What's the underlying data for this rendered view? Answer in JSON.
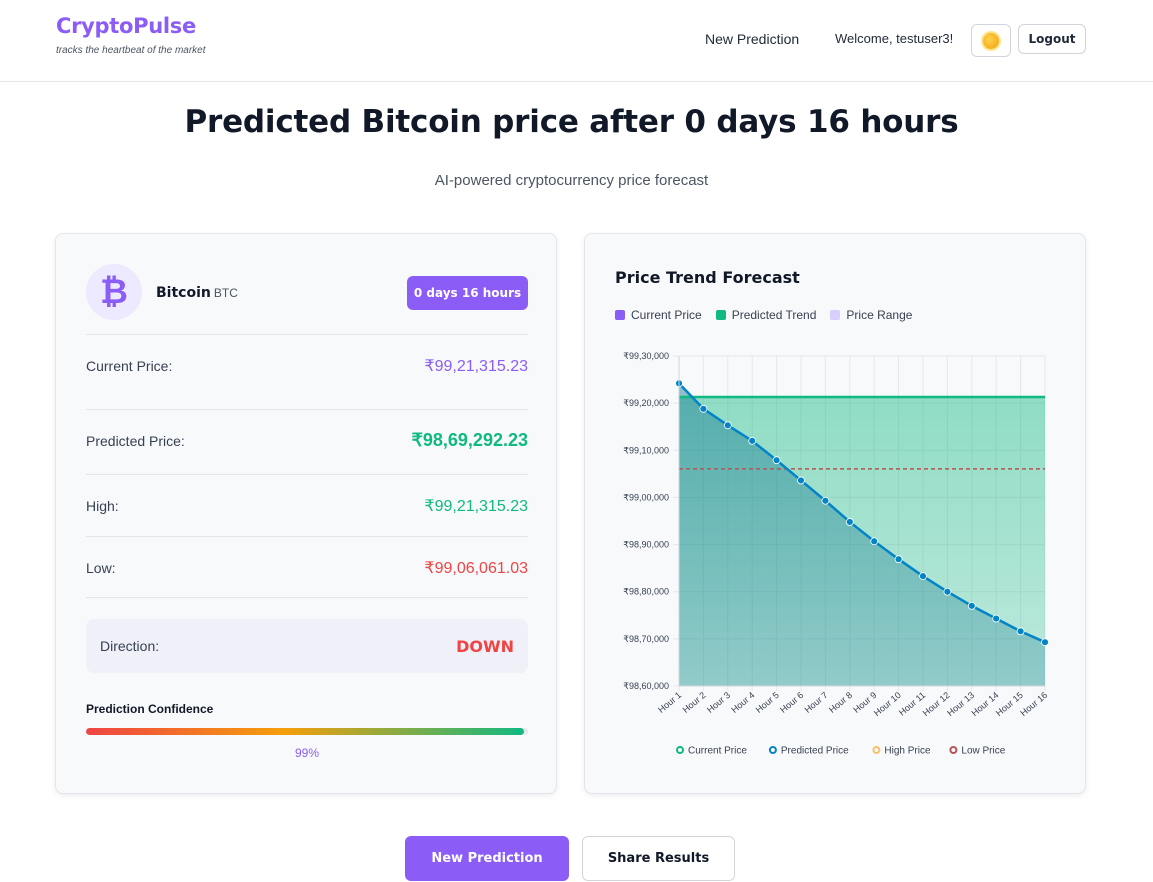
{
  "header": {
    "brand": "CryptoPulse",
    "tagline": "tracks the heartbeat of the market",
    "nav_new_prediction": "New Prediction",
    "welcome": "Welcome, testuser3!",
    "theme_icon": "sun-icon",
    "logout": "Logout"
  },
  "page": {
    "title": "Predicted Bitcoin price after 0 days 16 hours",
    "subtitle": "AI-powered cryptocurrency price forecast"
  },
  "coin": {
    "icon": "bitcoin-icon",
    "symbol_glyph": "₿",
    "name": "Bitcoin",
    "ticker": "BTC",
    "duration": "0 days 16 hours"
  },
  "prices": {
    "current_label": "Current Price:",
    "current_value": "₹99,21,315.23",
    "predicted_label": "Predicted Price:",
    "predicted_value": "₹98,69,292.23",
    "high_label": "High:",
    "high_value": "₹99,21,315.23",
    "low_label": "Low:",
    "low_value": "₹99,06,061.03"
  },
  "direction": {
    "label": "Direction:",
    "value": "DOWN"
  },
  "confidence": {
    "label": "Prediction Confidence",
    "value_text": "99%",
    "value": 0.99
  },
  "chart_card": {
    "title": "Price Trend Forecast",
    "legend": [
      {
        "label": "Current Price",
        "color": "#8b5cf6"
      },
      {
        "label": "Predicted Trend",
        "color": "#10b981"
      },
      {
        "label": "Price Range",
        "color": "#d8cffc"
      }
    ]
  },
  "chart_data": {
    "type": "line",
    "categories": [
      "Hour 1",
      "Hour 2",
      "Hour 3",
      "Hour 4",
      "Hour 5",
      "Hour 6",
      "Hour 7",
      "Hour 8",
      "Hour 9",
      "Hour 10",
      "Hour 11",
      "Hour 12",
      "Hour 13",
      "Hour 14",
      "Hour 15",
      "Hour 16"
    ],
    "ylim": [
      9860000,
      9930000
    ],
    "yticks": [
      9860000,
      9870000,
      9880000,
      9890000,
      9900000,
      9910000,
      9920000,
      9930000
    ],
    "ytick_labels": [
      "₹98,60,000",
      "₹98,70,000",
      "₹98,80,000",
      "₹98,90,000",
      "₹99,00,000",
      "₹99,10,000",
      "₹99,20,000",
      "₹99,30,000"
    ],
    "series": [
      {
        "name": "Current Price",
        "color": "#10b981",
        "values": [
          9921315.23,
          9921315.23,
          9921315.23,
          9921315.23,
          9921315.23,
          9921315.23,
          9921315.23,
          9921315.23,
          9921315.23,
          9921315.23,
          9921315.23,
          9921315.23,
          9921315.23,
          9921315.23,
          9921315.23,
          9921315.23
        ]
      },
      {
        "name": "Predicted Price",
        "color": "#0284c7",
        "values": [
          9924200,
          9918800,
          9915300,
          9912000,
          9907900,
          9903600,
          9899300,
          9894800,
          9890700,
          9886900,
          9883300,
          9880000,
          9877000,
          9874300,
          9871600,
          9869292.23
        ]
      },
      {
        "name": "High Price",
        "color": "#f5c26b",
        "values": []
      },
      {
        "name": "Low Price",
        "color": "#b45454",
        "values": [
          9906061.03,
          9906061.03,
          9906061.03,
          9906061.03,
          9906061.03,
          9906061.03,
          9906061.03,
          9906061.03,
          9906061.03,
          9906061.03,
          9906061.03,
          9906061.03,
          9906061.03,
          9906061.03,
          9906061.03,
          9906061.03
        ]
      }
    ],
    "grid": true,
    "legend_position": "bottom"
  },
  "actions": {
    "new_prediction": "New Prediction",
    "share": "Share Results"
  }
}
